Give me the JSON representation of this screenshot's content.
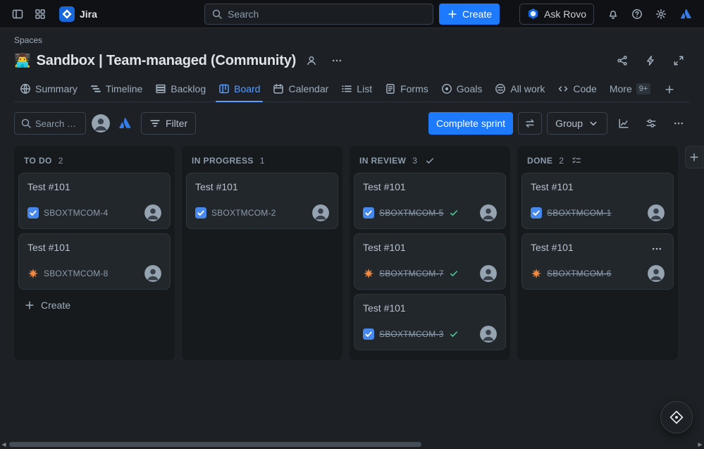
{
  "topbar": {
    "app_name": "Jira",
    "search_placeholder": "Search",
    "create_label": "Create",
    "ask_rovo_label": "Ask Rovo"
  },
  "header": {
    "breadcrumb": "Spaces",
    "project_emoji": "👨‍💻",
    "title": "Sandbox | Team-managed (Community)"
  },
  "tabs": {
    "items": [
      {
        "id": "summary",
        "label": "Summary",
        "icon": "globe"
      },
      {
        "id": "timeline",
        "label": "Timeline",
        "icon": "timeline"
      },
      {
        "id": "backlog",
        "label": "Backlog",
        "icon": "backlog"
      },
      {
        "id": "board",
        "label": "Board",
        "icon": "board",
        "active": true
      },
      {
        "id": "calendar",
        "label": "Calendar",
        "icon": "calendar"
      },
      {
        "id": "list",
        "label": "List",
        "icon": "list"
      },
      {
        "id": "forms",
        "label": "Forms",
        "icon": "forms"
      },
      {
        "id": "goals",
        "label": "Goals",
        "icon": "goals"
      },
      {
        "id": "all-work",
        "label": "All work",
        "icon": "all-work"
      },
      {
        "id": "code",
        "label": "Code",
        "icon": "code"
      },
      {
        "id": "more",
        "label": "More",
        "badge": "9+"
      }
    ]
  },
  "toolbar": {
    "search_placeholder": "Search board",
    "filter_label": "Filter",
    "complete_sprint_label": "Complete sprint",
    "group_label": "Group"
  },
  "board": {
    "columns": [
      {
        "id": "todo",
        "name": "TO DO",
        "count": "2",
        "header_icon": null,
        "show_create": true,
        "create_label": "Create",
        "cards": [
          {
            "title": "Test #101",
            "key": "SBOXTMCOM-4",
            "type": "task",
            "resolved": false
          },
          {
            "title": "Test #101",
            "key": "SBOXTMCOM-8",
            "type": "orange-burst",
            "resolved": false
          }
        ]
      },
      {
        "id": "in-progress",
        "name": "IN PROGRESS",
        "count": "1",
        "header_icon": null,
        "show_create": false,
        "cards": [
          {
            "title": "Test #101",
            "key": "SBOXTMCOM-2",
            "type": "task",
            "resolved": false
          }
        ]
      },
      {
        "id": "in-review",
        "name": "IN REVIEW",
        "count": "3",
        "header_icon": "check",
        "show_create": false,
        "cards": [
          {
            "title": "Test #101",
            "key": "SBOXTMCOM-5",
            "type": "task",
            "resolved": true,
            "show_check": true
          },
          {
            "title": "Test #101",
            "key": "SBOXTMCOM-7",
            "type": "orange-burst",
            "resolved": true,
            "show_check": true
          },
          {
            "title": "Test #101",
            "key": "SBOXTMCOM-3",
            "type": "task",
            "resolved": true,
            "show_check": true
          }
        ]
      },
      {
        "id": "done",
        "name": "DONE",
        "count": "2",
        "header_icon": "checklist",
        "show_create": false,
        "cards": [
          {
            "title": "Test #101",
            "key": "SBOXTMCOM-1",
            "type": "task",
            "resolved": true,
            "show_check": false
          },
          {
            "title": "Test #101",
            "key": "SBOXTMCOM-6",
            "type": "orange-burst",
            "resolved": true,
            "show_check": false,
            "show_menu": true
          }
        ]
      }
    ]
  },
  "colors": {
    "accent_blue": "#579DFF",
    "primary_button_blue": "#1D7AFC",
    "success_green": "#4BCE97",
    "issue_type_orange": "#F38A3F"
  }
}
